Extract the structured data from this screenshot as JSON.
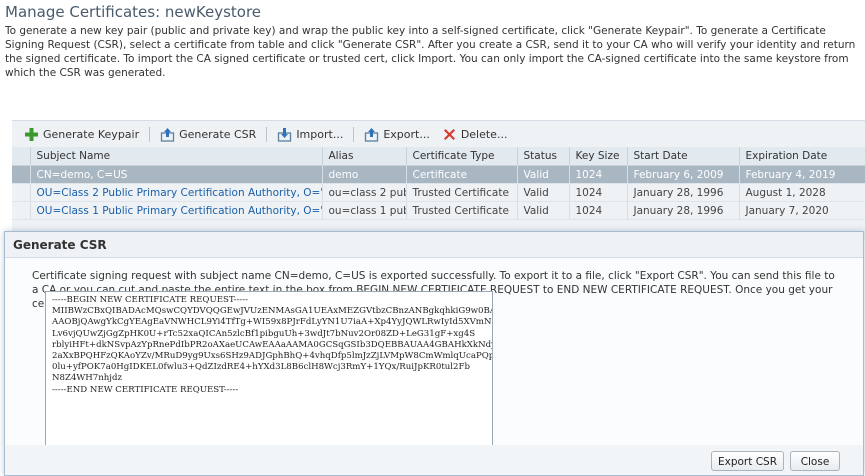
{
  "page": {
    "title": "Manage Certificates: newKeystore",
    "description": "To generate a new key pair (public and private key) and wrap the public key into a self-signed certificate, click \"Generate Keypair\". To generate a Certificate Signing Request (CSR), select a certificate from table and click \"Generate CSR\". After you create a CSR, send it to your CA who will verify your identity and return the signed certificate. To import the CA signed certificate or trusted cert, click Import. You can only import the CA-signed certificate into the same keystore from which the CSR was generated."
  },
  "toolbar": {
    "generate_keypair": "Generate Keypair",
    "generate_csr": "Generate CSR",
    "import": "Import...",
    "export": "Export...",
    "delete": "Delete..."
  },
  "table": {
    "columns": [
      "Subject Name",
      "Alias",
      "Certificate Type",
      "Status",
      "Key Size",
      "Start Date",
      "Expiration Date"
    ],
    "rows": [
      [
        "CN=demo, C=US",
        "demo",
        "Certificate",
        "Valid",
        "1024",
        "February 6, 2009",
        "February 4, 2019"
      ],
      [
        "OU=Class 2 Public Primary Certification Authority, O=\"V",
        "ou=class 2 publ",
        "Trusted Certificate",
        "Valid",
        "1024",
        "January 28, 1996",
        "August 1, 2028"
      ],
      [
        "OU=Class 1 Public Primary Certification Authority, O=\"V",
        "ou=class 1 publ",
        "Trusted Certificate",
        "Valid",
        "1024",
        "January 28, 1996",
        "January 7, 2020"
      ]
    ]
  },
  "dialog": {
    "title": "Generate CSR",
    "message": "Certificate signing request with subject name CN=demo, C=US is exported successfully. To export it to a file, click \"Export CSR\". You can send this file to a CA or you can cut and paste the entire text in the box from BEGIN NEW CERTIFICATE REQUEST to END NEW CERTIFICATE REQUEST. Once you get your certificate back from CA you can continue with import.",
    "csr_text": "-----BEGIN NEW CERTIFICATE REQUEST-----\nMIIBWzCBxQIBADAcMQswCQYDVQQGEwJVUzENMAsGA1UEAxMEZGVtbzCBnzANBgkqhkiG9w0BAQEF\nAAOBjQAwgYkCgYEAgEaVNWHCL9Yi4TfTg+WI59x8PJrFdLyYN1U7iaA+Xp4YyJQWLRwIyId5XVmN\nLv6vjQUwZjGgZpHK0U+rTc52xaQICAn5zlcBf1pibguUh+3wdJt7bNuv2Or08ZD+LeG31gF+xg4S\nrblyiHFt+dkNSvpAzYpRnePdIbPR2oAXaeUCAwEAAaAAMA0GCSqGSIb3DQEBBAUAA4GBAHkXkNdy\n2aXxBPQHFzQKAoYZv/MRuD9yg9Uxs6SHz9ADJGphBhQ+4vhqDfp5lmJzZjLVMpW8CmWmlqUcaPQp\n0lu+yfPOK7a0HgIDKEL0fwlu3+QdZIzdRE4+hYXd3L8B6clH8Wcj3RmY+1YQx/RuiJpKR0tul2Fb\nN8Z4WH7nhjdz\n-----END NEW CERTIFICATE REQUEST-----",
    "export_button": "Export CSR",
    "close_button": "Close"
  },
  "colors": {
    "accent_green": "#3c9a2e",
    "delete_red": "#d63a2c",
    "selected_row": "#a9b7c3",
    "link_blue": "#1a5fa8"
  }
}
